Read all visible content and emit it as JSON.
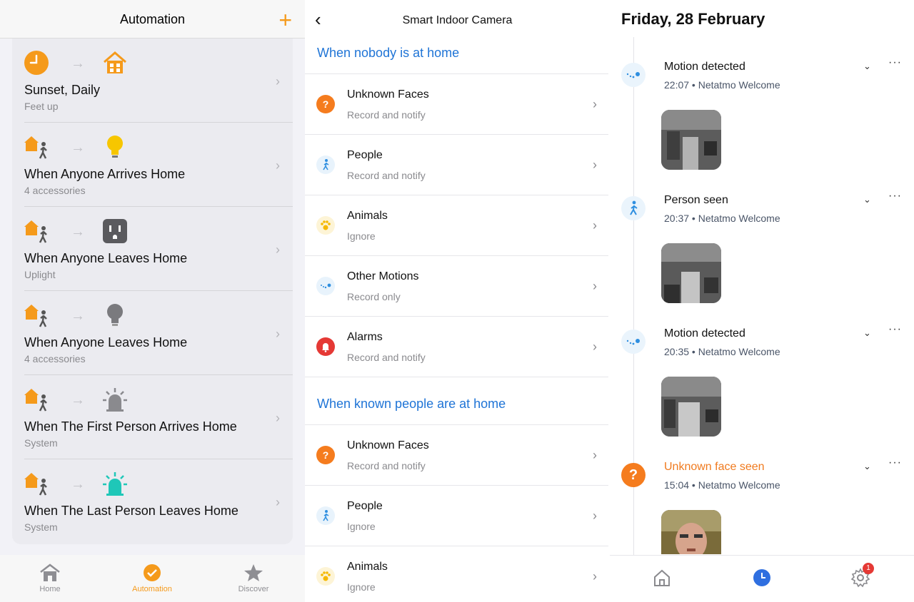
{
  "automation": {
    "title": "Automation",
    "add_label": "+",
    "rows": [
      {
        "name": "Sunset, Daily",
        "sub": "Feet up",
        "trigger_icon": "clock-icon",
        "target_icon": "house-icon"
      },
      {
        "name": "When Anyone Arrives Home",
        "sub": "4 accessories",
        "trigger_icon": "person-arrives-icon",
        "target_icon": "lightbulb-icon"
      },
      {
        "name": "When Anyone Leaves Home",
        "sub": "Uplight",
        "trigger_icon": "person-leaves-icon",
        "target_icon": "outlet-icon"
      },
      {
        "name": "When Anyone Leaves Home",
        "sub": "4 accessories",
        "trigger_icon": "person-leaves-icon",
        "target_icon": "lightbulb-off-icon"
      },
      {
        "name": "When The First Person Arrives Home",
        "sub": "System",
        "trigger_icon": "person-arrives-icon",
        "target_icon": "siren-icon"
      },
      {
        "name": "When The Last Person Leaves Home",
        "sub": "System",
        "trigger_icon": "person-leaves-icon",
        "target_icon": "siren-active-icon"
      }
    ],
    "tabs": [
      {
        "label": "Home",
        "active": false
      },
      {
        "label": "Automation",
        "active": true
      },
      {
        "label": "Discover",
        "active": false
      }
    ],
    "accent_color": "#f59a1b"
  },
  "camera": {
    "title": "Smart Indoor Camera",
    "section_nobody": "When nobody is at home",
    "section_known": "When known people are at home",
    "nobody_items": [
      {
        "name": "Unknown Faces",
        "sub": "Record and notify",
        "icon": "question-icon"
      },
      {
        "name": "People",
        "sub": "Record and notify",
        "icon": "walking-person-icon"
      },
      {
        "name": "Animals",
        "sub": "Ignore",
        "icon": "paw-icon"
      },
      {
        "name": "Other Motions",
        "sub": "Record only",
        "icon": "motion-icon"
      },
      {
        "name": "Alarms",
        "sub": "Record and notify",
        "icon": "bell-icon"
      }
    ],
    "known_items": [
      {
        "name": "Unknown Faces",
        "sub": "Record and notify",
        "icon": "question-icon"
      },
      {
        "name": "People",
        "sub": "Ignore",
        "icon": "walking-person-icon"
      },
      {
        "name": "Animals",
        "sub": "Ignore",
        "icon": "paw-icon"
      }
    ],
    "link_color": "#1f74d6"
  },
  "timeline": {
    "date": "Friday, 28 February",
    "events": [
      {
        "title": "Motion detected",
        "meta": "22:07 • Netatmo Welcome",
        "icon": "motion-icon"
      },
      {
        "title": "Person seen",
        "meta": "20:37 • Netatmo Welcome",
        "icon": "walking-person-icon"
      },
      {
        "title": "Motion detected",
        "meta": "20:35 • Netatmo Welcome",
        "icon": "motion-icon"
      },
      {
        "title": "Unknown face seen",
        "meta": "15:04 • Netatmo Welcome",
        "icon": "question-icon"
      }
    ],
    "settings_badge": "1"
  }
}
